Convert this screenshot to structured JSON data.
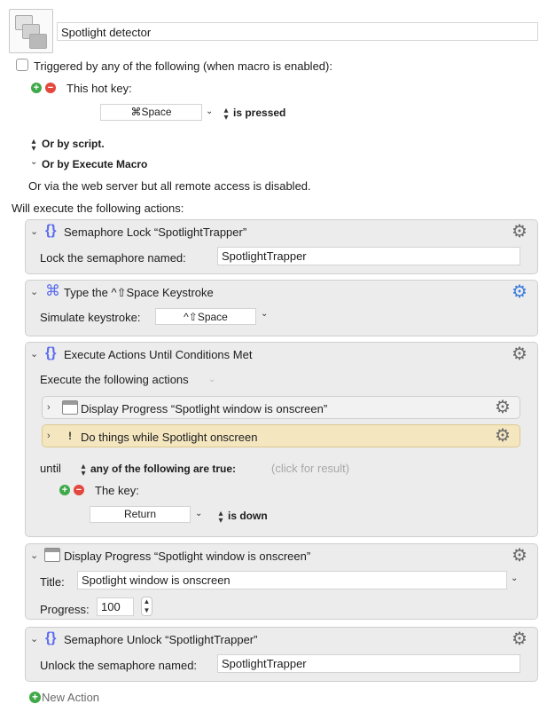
{
  "macro": {
    "name": "Spotlight detector"
  },
  "triggers": {
    "header": "Triggered by any of the following (when macro is enabled):",
    "hotkey_label": "This hot key:",
    "hotkey_value": "⌘Space",
    "hotkey_condition": "is pressed",
    "or_by_script": "Or by script.",
    "or_by_execute_macro": "Or by Execute Macro",
    "web_server_note": "Or via the web server but all remote access is disabled."
  },
  "actions_header": "Will execute the following actions:",
  "actions": {
    "lock": {
      "title": "Semaphore Lock “SpotlightTrapper”",
      "field_label": "Lock the semaphore named:",
      "field_value": "SpotlightTrapper"
    },
    "type_keystroke": {
      "title": "Type the ^⇧Space Keystroke",
      "field_label": "Simulate keystroke:",
      "field_value": "^⇧Space"
    },
    "until": {
      "title": "Execute Actions Until Conditions Met",
      "subheader": "Execute the following actions",
      "sub_actions": [
        {
          "title": "Display Progress “Spotlight window is onscreen”"
        },
        {
          "title": "Do things while Spotlight onscreen"
        }
      ],
      "until_label": "until",
      "condition_mode": "any of the following are true:",
      "click_for_result": "(click for result)",
      "key_label": "The key:",
      "key_value": "Return",
      "key_condition": "is down"
    },
    "progress": {
      "title": "Display Progress “Spotlight window is onscreen”",
      "title_label": "Title:",
      "title_value": "Spotlight window is onscreen",
      "progress_label": "Progress:",
      "progress_value": "100"
    },
    "unlock": {
      "title": "Semaphore Unlock “SpotlightTrapper”",
      "field_label": "Unlock the semaphore named:",
      "field_value": "SpotlightTrapper"
    }
  },
  "new_action": "New Action",
  "colors": {
    "accent_blue": "#5b6cf0",
    "add_green": "#3fa94a",
    "remove_red": "#e2483d",
    "warn_bg": "#f4e6bf"
  }
}
